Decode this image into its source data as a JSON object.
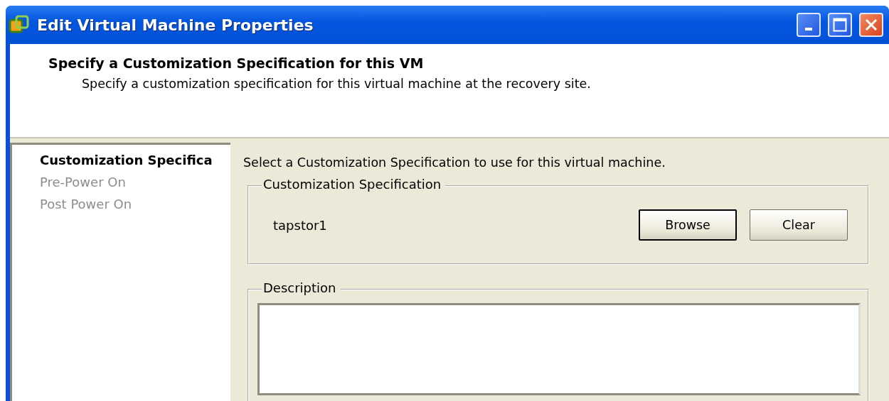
{
  "window": {
    "title": "Edit Virtual Machine Properties"
  },
  "header": {
    "title": "Specify a Customization Specification for this VM",
    "subtitle": "Specify a customization specification for this virtual machine at the recovery site."
  },
  "nav": {
    "items": [
      {
        "label": "Customization Specifica",
        "selected": true,
        "disabled": false
      },
      {
        "label": "Pre-Power On",
        "selected": false,
        "disabled": true
      },
      {
        "label": "Post Power On",
        "selected": false,
        "disabled": true
      }
    ]
  },
  "content": {
    "instruction": "Select a Customization Specification to use for this virtual machine.",
    "spec_group": {
      "legend": "Customization Specification",
      "value": "tapstor1",
      "buttons": [
        {
          "label": "Browse",
          "default": true
        },
        {
          "label": "Clear",
          "default": false
        }
      ]
    },
    "description_group": {
      "legend": "Description"
    }
  }
}
